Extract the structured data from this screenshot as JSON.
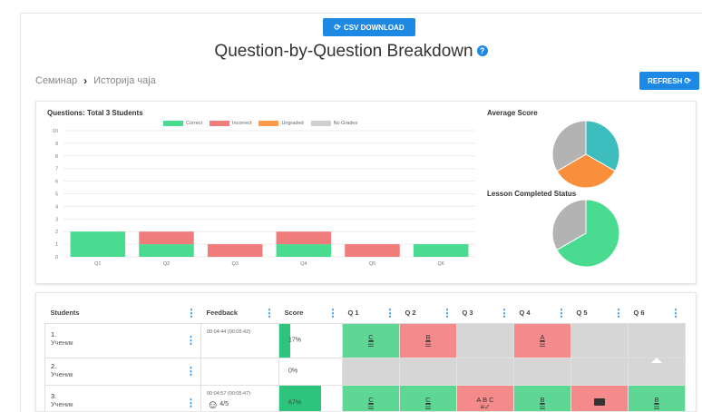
{
  "toolbar": {
    "csv_label": "CSV DOWNLOAD",
    "refresh_label": "REFRESH"
  },
  "page": {
    "title": "Question-by-Question Breakdown"
  },
  "breadcrumb": {
    "items": [
      "Семинар",
      "Историја чаја"
    ]
  },
  "charts": {
    "questions_title": "Questions: Total 3 Students",
    "average_title": "Average Score",
    "lesson_title": "Lesson Completed Status"
  },
  "chart_data": [
    {
      "type": "bar",
      "title": "Questions: Total 3 Students",
      "categories": [
        "Q1",
        "Q2",
        "Q3",
        "Q4",
        "Q5",
        "Q6"
      ],
      "series": [
        {
          "name": "Correct",
          "color": "#49dc90",
          "values": [
            2,
            1,
            0,
            1,
            0,
            1
          ]
        },
        {
          "name": "Incorrect",
          "color": "#f07c7c",
          "values": [
            0,
            1,
            1,
            1,
            1,
            0
          ]
        },
        {
          "name": "Ungraded",
          "color": "#ff9a4a",
          "values": [
            0,
            0,
            0,
            0,
            0,
            0
          ]
        },
        {
          "name": "No Grades",
          "color": "#d0d0d0",
          "values": [
            0,
            0,
            0,
            0,
            0,
            0
          ]
        }
      ],
      "stacked": true,
      "ylim": [
        0,
        10
      ],
      "yticks": [
        0,
        1,
        2,
        3,
        4,
        5,
        6,
        7,
        8,
        9,
        10
      ]
    },
    {
      "type": "pie",
      "title": "Average Score",
      "slices": [
        {
          "color": "#3dbdbd",
          "value": 33.3
        },
        {
          "color": "#f98f3a",
          "value": 33.3
        },
        {
          "color": "#b3b3b3",
          "value": 33.4
        }
      ]
    },
    {
      "type": "pie",
      "title": "Lesson Completed Status",
      "slices": [
        {
          "color": "#49dc90",
          "value": 66.7
        },
        {
          "color": "#b3b3b3",
          "value": 33.3
        }
      ]
    }
  ],
  "table": {
    "headers": {
      "students": "Students",
      "feedback": "Feedback",
      "score": "Score"
    },
    "questions": [
      "Q 1",
      "Q 2",
      "Q 3",
      "Q 4",
      "Q 5",
      "Q 6"
    ],
    "rows": [
      {
        "name": "1.",
        "role": "Ученик",
        "feedback": "00:04:44 (00:05:42)",
        "rating": "",
        "score": "17%",
        "score_value": 17,
        "answers": [
          {
            "status": "correct",
            "text": "C"
          },
          {
            "status": "incorrect",
            "text": "B"
          },
          {
            "status": "none",
            "text": ""
          },
          {
            "status": "incorrect",
            "text": "A"
          },
          {
            "status": "none",
            "text": ""
          },
          {
            "status": "none",
            "text": ""
          }
        ]
      },
      {
        "name": "2.",
        "role": "Ученик",
        "feedback": "",
        "rating": "",
        "score": "0%",
        "score_value": 0,
        "answers": [
          {
            "status": "none",
            "text": ""
          },
          {
            "status": "none",
            "text": ""
          },
          {
            "status": "none",
            "text": ""
          },
          {
            "status": "none",
            "text": ""
          },
          {
            "status": "none",
            "text": ""
          },
          {
            "status": "none",
            "text": ""
          }
        ]
      },
      {
        "name": "3.",
        "role": "Ученик",
        "feedback": "00:04:57 (00:05:47)",
        "rating": "4/5",
        "score": "67%",
        "score_value": 67,
        "answers": [
          {
            "status": "correct",
            "text": "C"
          },
          {
            "status": "correct",
            "text": "C"
          },
          {
            "status": "incorrect",
            "text": "A B C"
          },
          {
            "status": "correct",
            "text": "B"
          },
          {
            "status": "incorrect",
            "text": ""
          },
          {
            "status": "correct",
            "text": "B"
          }
        ]
      }
    ]
  }
}
